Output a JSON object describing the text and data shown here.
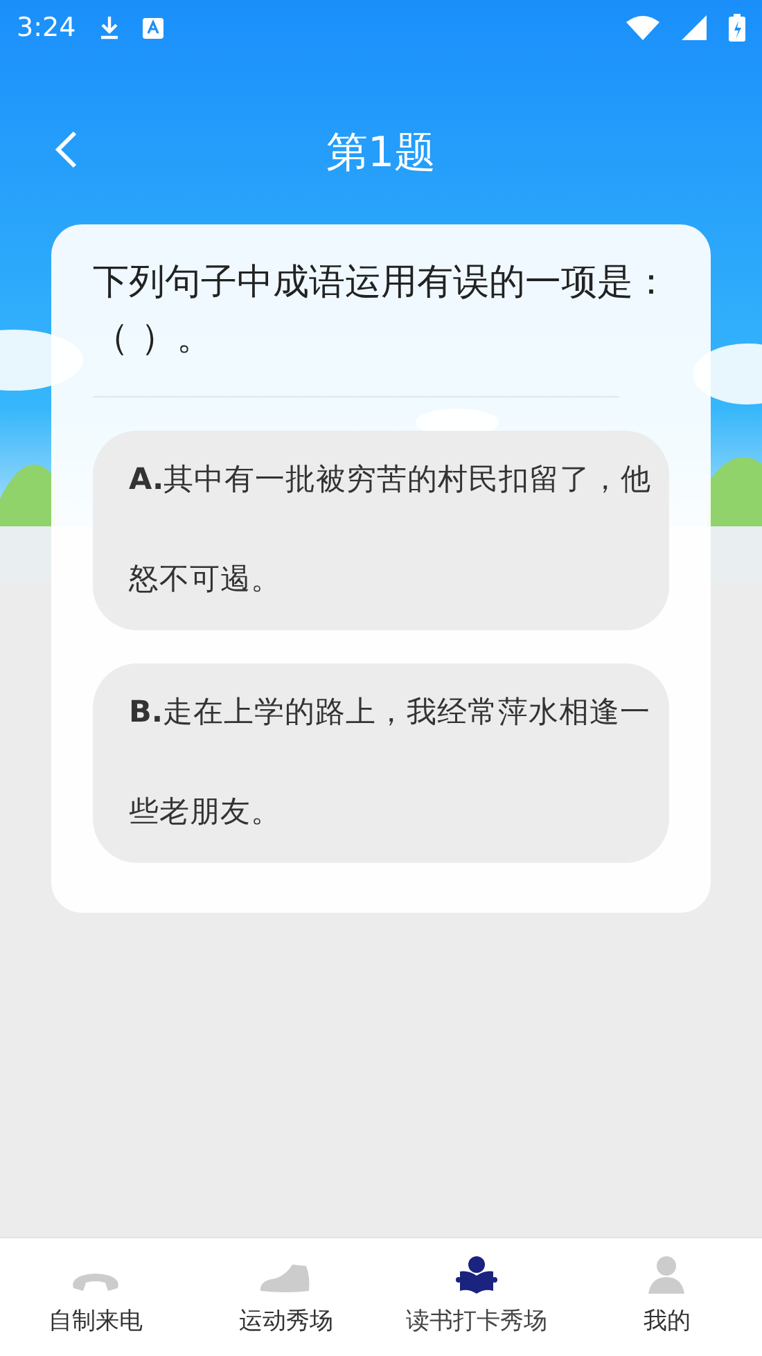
{
  "status_bar": {
    "time": "3:24"
  },
  "header": {
    "title": "第1题"
  },
  "question": {
    "text": "下列句子中成语运用有误的一项是：（ ）。",
    "options": [
      {
        "text": "**A.**其中有一批被穷苦的村民扣留了，他怒不可遏。",
        "selected": false
      },
      {
        "text": "**B.**走在上学的路上，我经常萍水相逢一些老朋友。",
        "selected": false
      }
    ]
  },
  "bottom_nav": [
    {
      "label": "自制来电",
      "kind": "phone",
      "selected": false
    },
    {
      "label": "运动秀场",
      "kind": "shoe",
      "selected": false
    },
    {
      "label": "读书打卡秀场",
      "kind": "book",
      "selected": true
    },
    {
      "label": "我的",
      "kind": "person",
      "selected": false
    }
  ]
}
